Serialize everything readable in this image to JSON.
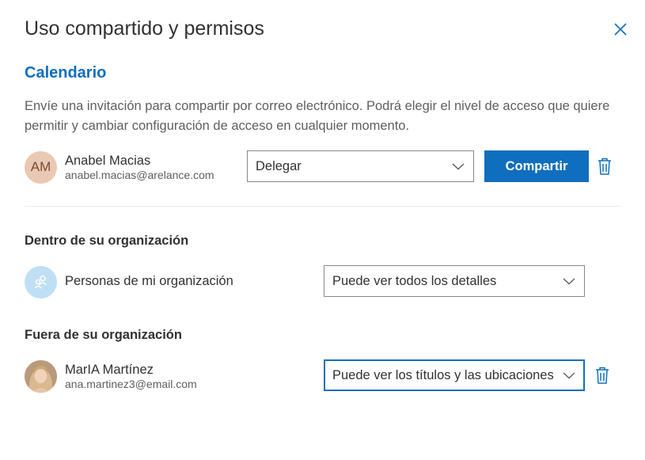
{
  "dialog": {
    "title": "Uso compartido y permisos",
    "section_title": "Calendario",
    "description": "Envíe una invitación para compartir por correo electrónico. Podrá elegir el nivel de acceso que quiere permitir y cambiar configuración de acceso en cualquier momento."
  },
  "invite": {
    "avatar_initials": "AM",
    "name": "Anabel Macias",
    "email": "anabel.macias@arelance.com",
    "permission": "Delegar",
    "share_label": "Compartir"
  },
  "inside": {
    "title": "Dentro de su organización",
    "label": "Personas de mi organización",
    "permission": "Puede ver todos los detalles"
  },
  "outside": {
    "title": "Fuera de su organización",
    "name": "MarIA Martínez",
    "email": "ana.martinez3@email.com",
    "permission": "Puede ver los títulos y las ubicaciones"
  },
  "colors": {
    "accent": "#106ebe",
    "text": "#323130",
    "secondary_text": "#605e5c",
    "divider": "#edebe9"
  },
  "icons": {
    "close": "close-icon",
    "chevron": "chevron-down-icon",
    "delete": "trash-icon",
    "organization": "people-icon"
  }
}
